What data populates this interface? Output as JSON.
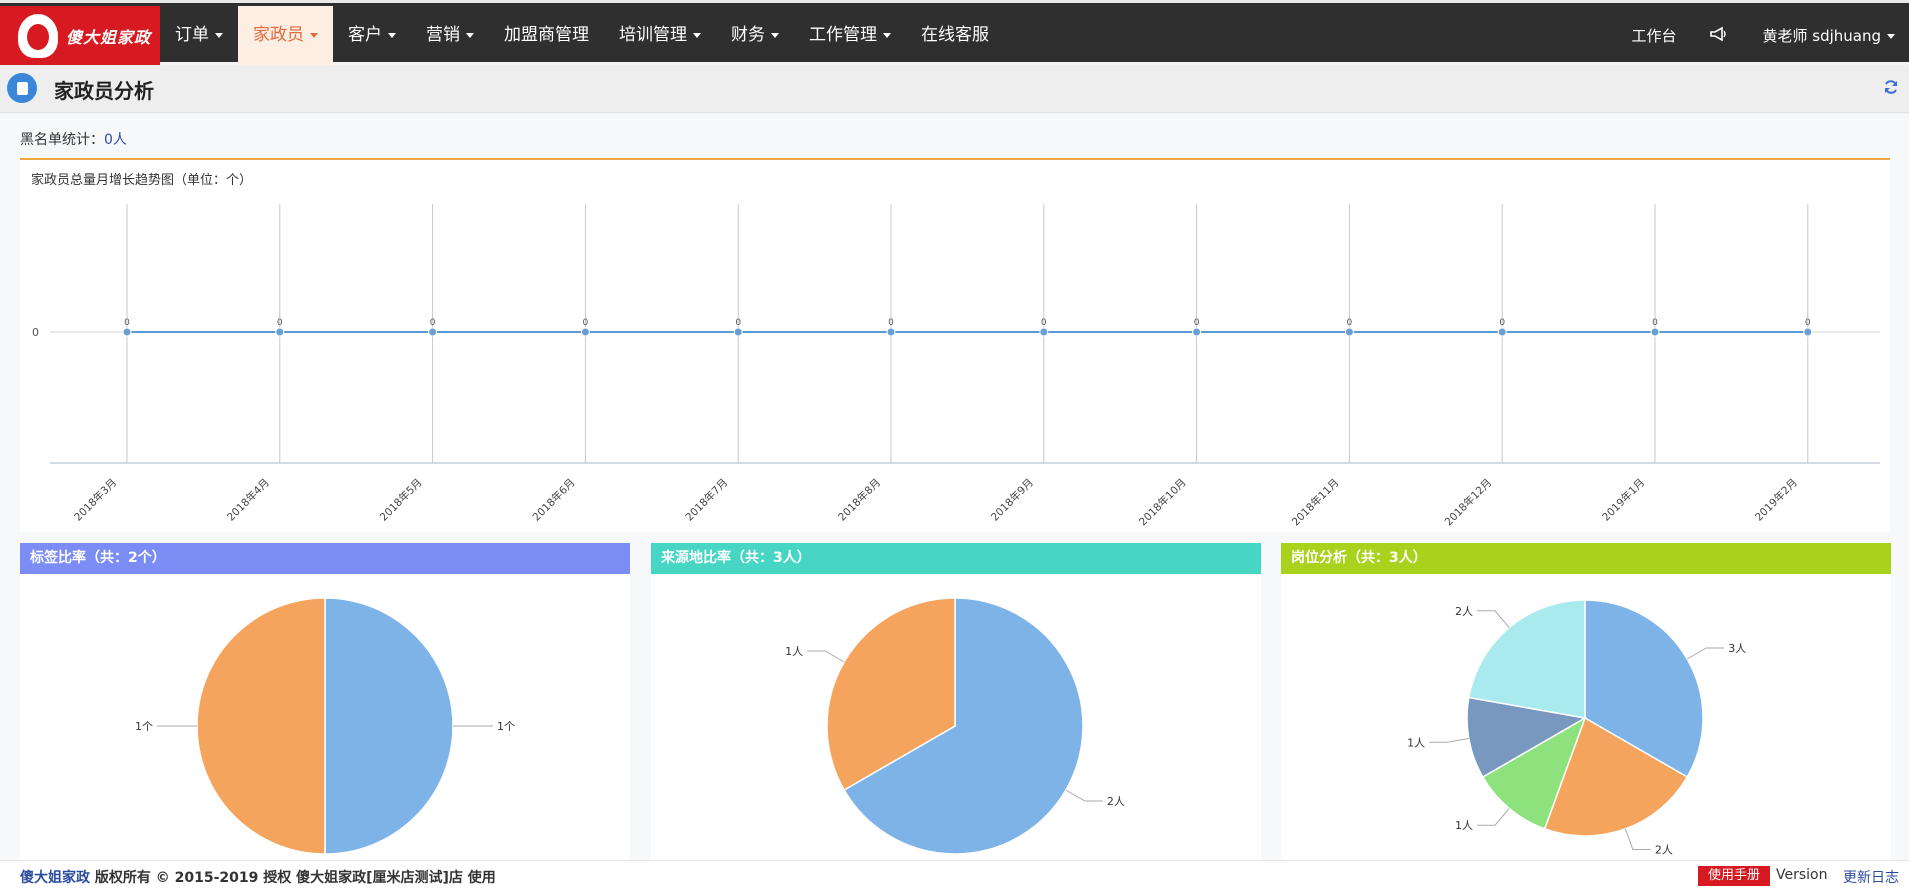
{
  "brand": {
    "logo_text": "傻大姐家政"
  },
  "nav": {
    "items": [
      {
        "label": "订单",
        "dropdown": true,
        "active": false
      },
      {
        "label": "家政员",
        "dropdown": true,
        "active": true
      },
      {
        "label": "客户",
        "dropdown": true,
        "active": false
      },
      {
        "label": "营销",
        "dropdown": true,
        "active": false
      },
      {
        "label": "加盟商管理",
        "dropdown": false,
        "active": false
      },
      {
        "label": "培训管理",
        "dropdown": true,
        "active": false
      },
      {
        "label": "财务",
        "dropdown": true,
        "active": false
      },
      {
        "label": "工作管理",
        "dropdown": true,
        "active": false
      },
      {
        "label": "在线客服",
        "dropdown": false,
        "active": false
      }
    ],
    "workbench": "工作台",
    "user": "黄老师 sdjhuang"
  },
  "page": {
    "title": "家政员分析"
  },
  "blacklist": {
    "label": "黑名单统计：",
    "value": "0人"
  },
  "line_panel": {
    "title": "家政员总量月增长趋势图（单位：个）"
  },
  "pies": [
    {
      "title": "标签比率（共：2个）",
      "header_color": "#7b8cf5"
    },
    {
      "title": "来源地比率（共：3人）",
      "header_color": "#47d6c4"
    },
    {
      "title": "岗位分析（共：3人）",
      "header_color": "#a8d21c"
    }
  ],
  "chart_data": [
    {
      "type": "line",
      "title": "家政员总量月增长趋势图（单位：个）",
      "categories": [
        "2018年3月",
        "2018年4月",
        "2018年5月",
        "2018年6月",
        "2018年7月",
        "2018年8月",
        "2018年9月",
        "2018年10月",
        "2018年11月",
        "2018年12月",
        "2019年1月",
        "2019年2月"
      ],
      "series": [
        {
          "values": [
            0,
            0,
            0,
            0,
            0,
            0,
            0,
            0,
            0,
            0,
            0,
            0
          ],
          "data_labels": [
            "0",
            "0",
            "0",
            "0",
            "0",
            "0",
            "0",
            "0",
            "0",
            "0",
            "0",
            "0"
          ]
        }
      ],
      "y_tick_labels": [
        "0"
      ],
      "grid": true,
      "color": "#5b9bd5"
    },
    {
      "type": "pie",
      "title": "标签比率（共：2个）",
      "slices": [
        {
          "value": 1,
          "label": "1个",
          "color": "#7eb3e8"
        },
        {
          "value": 1,
          "label": "1个",
          "color": "#f5a45d"
        }
      ]
    },
    {
      "type": "pie",
      "title": "来源地比率（共：3人）",
      "slices": [
        {
          "value": 2,
          "label": "2人",
          "color": "#7eb3e8"
        },
        {
          "value": 1,
          "label": "1人",
          "color": "#f5a45d"
        }
      ]
    },
    {
      "type": "pie",
      "title": "岗位分析（共：3人）",
      "slices": [
        {
          "value": 3,
          "label": "3人",
          "color": "#7eb3e8"
        },
        {
          "value": 2,
          "label": "2人",
          "color": "#f5a45d"
        },
        {
          "value": 1,
          "label": "1人",
          "color": "#8ee27d"
        },
        {
          "value": 1,
          "label": "1人",
          "color": "#7898c0"
        },
        {
          "value": 2,
          "label": "2人",
          "color": "#a8eaee"
        }
      ]
    }
  ],
  "footer": {
    "brand_link": "傻大姐家政",
    "copyright": " 版权所有 © 2015-2019 授权 傻大姐家政[厘米店测试]店 使用",
    "manual": "使用手册",
    "version": "Version",
    "changelog": "更新日志"
  }
}
